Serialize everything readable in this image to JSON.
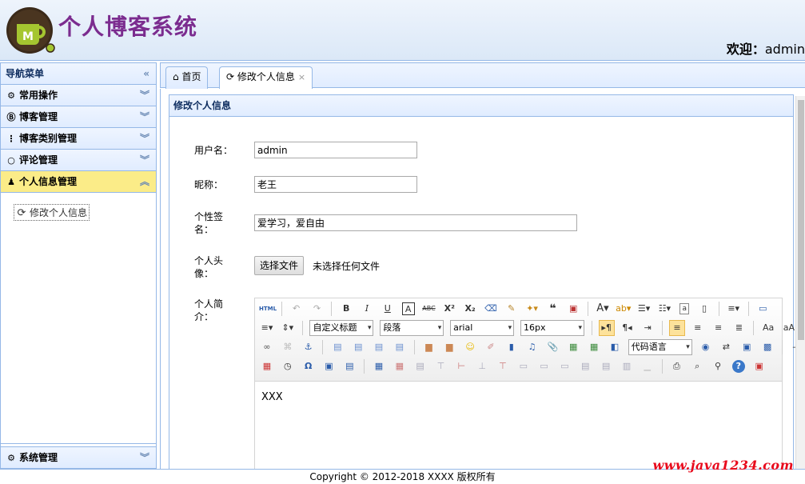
{
  "header": {
    "app_title": "个人博客系统",
    "welcome_label": "欢迎：",
    "username": "admin"
  },
  "sidebar": {
    "title": "导航菜单",
    "items": [
      {
        "label": "常用操作",
        "icon": "gear-icon"
      },
      {
        "label": "博客管理",
        "icon": "blog-icon"
      },
      {
        "label": "博客类别管理",
        "icon": "tree-icon"
      },
      {
        "label": "评论管理",
        "icon": "comment-icon"
      },
      {
        "label": "个人信息管理",
        "icon": "user-icon",
        "active": true
      }
    ],
    "sub_items": [
      {
        "label": "修改个人信息",
        "icon": "refresh-icon"
      }
    ],
    "system": {
      "label": "系统管理",
      "icon": "settings-icon"
    }
  },
  "tabs": [
    {
      "label": "首页",
      "icon": "home-icon"
    },
    {
      "label": "修改个人信息",
      "icon": "refresh-icon",
      "active": true,
      "close": "×"
    }
  ],
  "panel": {
    "title": "修改个人信息"
  },
  "form": {
    "username_label": "用户名：",
    "username_value": "admin",
    "nickname_label": "昵称：",
    "nickname_value": "老王",
    "sign_label": "个性签名：",
    "sign_value": "爱学习，爱自由",
    "avatar_label": "个人头像：",
    "file_button": "选择文件",
    "file_status": "未选择任何文件",
    "profile_label": "个人简介："
  },
  "editor": {
    "html_label": "HTML",
    "heading_select": "自定义标题",
    "paragraph_select": "段落",
    "font_select": "arial",
    "size_select": "16px",
    "code_select": "代码语言",
    "content": "XXX"
  },
  "footer": {
    "copyright": "Copyright © 2012-2018 XXXX 版权所有"
  },
  "watermark": "www.java1234.com",
  "colors": {
    "title_purple": "#7b2c8f",
    "border_blue": "#95b8e7",
    "active_yellow": "#fbec88",
    "watermark_red": "#e8091c"
  }
}
